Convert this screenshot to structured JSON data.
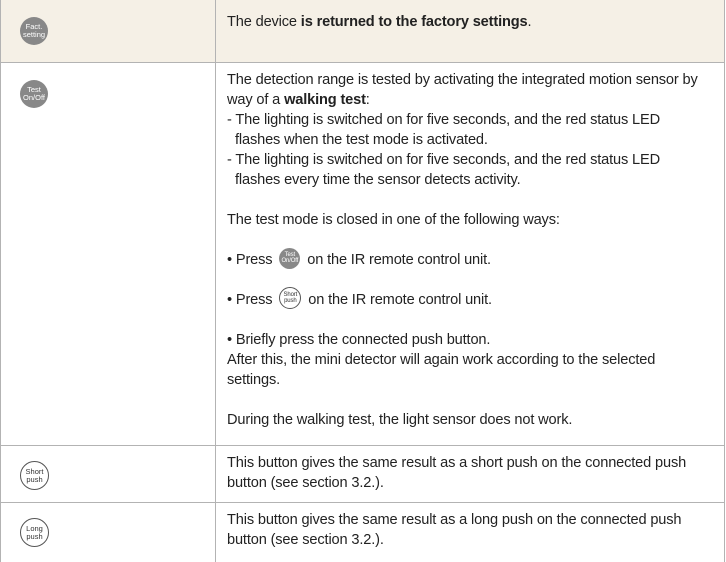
{
  "rows": [
    {
      "button": {
        "line1": "Fact.",
        "line2": "setting"
      },
      "text": {
        "pre": "The device ",
        "bold": "is returned to the factory settings",
        "post": "."
      }
    },
    {
      "button": {
        "line1": "Test",
        "line2": "On/Off"
      },
      "intro": {
        "line1": "The detection range is tested by activating the integrated motion sensor by",
        "line2_pre": "way of a ",
        "line2_bold": "walking test",
        "line2_post": ":"
      },
      "bullets": [
        {
          "line1": "- The lighting is switched on for five seconds, and the red status LED",
          "line2": "flashes when the test mode is activated."
        },
        {
          "line1": "- The lighting is switched on for five seconds, and the red status LED",
          "line2": "flashes every time the sensor detects activity."
        }
      ],
      "close_intro": "The test mode is closed in one of the following ways:",
      "option1": {
        "pre": "• Press ",
        "icon": {
          "line1": "Test",
          "line2": "On/Off"
        },
        "post": " on the IR remote control unit."
      },
      "option2": {
        "pre": "• Press ",
        "icon": {
          "line1": "Short",
          "line2": "push"
        },
        "post": " on the IR remote control unit."
      },
      "option3": "• Briefly press the connected push button.",
      "after": {
        "line1": "After this, the mini detector will again work according to the selected",
        "line2": "settings."
      },
      "note": "During the walking test, the light sensor does not work."
    },
    {
      "button": {
        "line1": "Short",
        "line2": "push"
      },
      "text": {
        "line1": "This button gives the same result as a short push on the connected push",
        "line2": "button (see section 3.2.)."
      }
    },
    {
      "button": {
        "line1": "Long",
        "line2": "push"
      },
      "text": {
        "line1": "This button gives the same result as a long push on the connected push",
        "line2": "button (see section 3.2.)."
      }
    }
  ],
  "colors": {
    "row_highlight": "#f5f0e6",
    "border": "#b3b3b3",
    "button_gray": "#888888"
  }
}
